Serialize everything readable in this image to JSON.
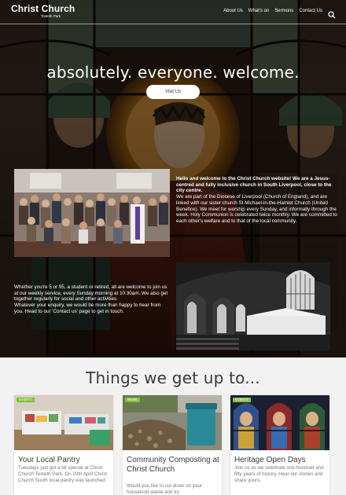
{
  "header": {
    "logo_title": "Christ Church",
    "logo_subtitle": "Toxteth Park",
    "nav": [
      "About Us",
      "What's on",
      "Sermons",
      "Contact Us"
    ],
    "search_icon": "search-icon"
  },
  "hero": {
    "headline": "absolutely. everyone. welcome.",
    "button_label": "Visit Us"
  },
  "intro": {
    "lead": "Hello and welcome to the Christ Church website! We are a Jesus-centred and fully inclusive church in South Liverpool, close to the city centre.",
    "body": "We are part of the Diocese of Liverpool (Church of England), and are linked with our sister church St Michael-in-the-Hamlet Church (United Benefice). We meet for worship every Sunday, and informally through the week. Holy Communion is celebrated twice monthly. We are committed to each other's welfare and to that of the local community."
  },
  "welcome": {
    "p1": "Whether you're 5 or 95, a student or retired, all are welcome to join us at our weekly service, every Sunday morning at 10:30am. We also get together regularly for social and other activities.",
    "p2": "Whatever your enquiry, we would be more than happy to hear from you. Head to our 'Contact us' page to get in touch."
  },
  "events": {
    "title": "Things we get up to...",
    "cards": [
      {
        "badge": "Events",
        "title": "Your Local Pantry",
        "text": "Tuesdays just got a bit special at Christ Church Texteth Park. On 20th April Christ Church South local pantry was launched"
      },
      {
        "badge": "News",
        "title": "Community Composting at Christ Church",
        "text": "Would you like to cut down on your household waste and try"
      },
      {
        "badge": "Events",
        "title": "Heritage Open Days",
        "text": "Join us as we celebrate one-hundred and fifty years of history. Hear our stories and share yours."
      }
    ]
  },
  "colors": {
    "badge": "#7fbf3f",
    "page_background": "#f2f2f2",
    "hero_overlay": "#1c130e"
  }
}
